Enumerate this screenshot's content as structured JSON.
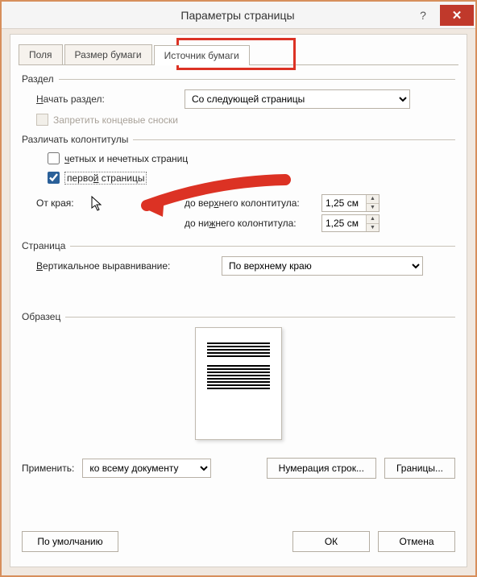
{
  "window": {
    "title": "Параметры страницы"
  },
  "tabs": {
    "fields": "Поля",
    "size": "Размер бумаги",
    "source": "Источник бумаги"
  },
  "section": {
    "header": "Раздел",
    "start_label": "Начать раздел:",
    "start_value": "Со следующей страницы",
    "suppress_endnotes": "Запретить концевые сноски"
  },
  "headers": {
    "header": "Различать колонтитулы",
    "odd_even": "четных и нечетных страниц",
    "first_page": "первой страницы",
    "from_edge": "От края:",
    "top_label": "до верхнего колонтитула:",
    "top_value": "1,25 см",
    "bottom_label": "до нижнего колонтитула:",
    "bottom_value": "1,25 см"
  },
  "page": {
    "header": "Страница",
    "valign_label": "Вертикальное выравнивание:",
    "valign_value": "По верхнему краю"
  },
  "preview": {
    "header": "Образец"
  },
  "apply": {
    "label": "Применить:",
    "value": "ко всему документу",
    "line_numbers": "Нумерация строк...",
    "borders": "Границы..."
  },
  "buttons": {
    "default": "По умолчанию",
    "ok": "ОК",
    "cancel": "Отмена"
  }
}
